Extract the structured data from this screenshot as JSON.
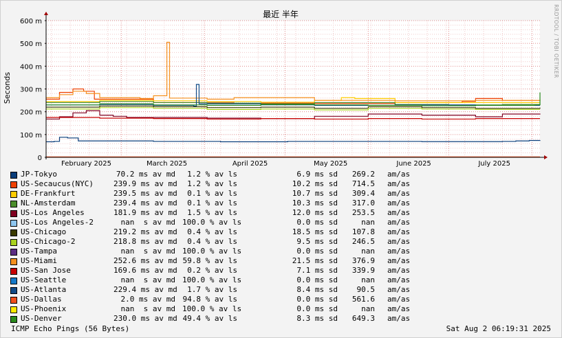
{
  "chart_data": {
    "type": "line",
    "title": "最近 半年",
    "ylabel": "Seconds",
    "vertical_label": "RRDTOOL / TOBI OETIKER",
    "y_ticks": [
      "0",
      "100 m",
      "200 m",
      "300 m",
      "400 m",
      "500 m",
      "600 m"
    ],
    "y_tick_values": [
      0,
      100,
      200,
      300,
      400,
      500,
      600
    ],
    "ylim": [
      0,
      600
    ],
    "x_ticks": [
      "February 2025",
      "March 2025",
      "April 2025",
      "May 2025",
      "June 2025",
      "July 2025"
    ],
    "x_tick_days": [
      15,
      45,
      76,
      106,
      137,
      167
    ],
    "xlim": [
      0,
      184
    ],
    "grid": true,
    "series": [
      {
        "name": "JP-Tokyo",
        "color": "#0a3d7a",
        "values": [
          [
            0,
            68
          ],
          [
            3,
            70
          ],
          [
            5,
            88
          ],
          [
            8,
            85
          ],
          [
            12,
            72
          ],
          [
            20,
            72
          ],
          [
            40,
            70
          ],
          [
            65,
            68
          ],
          [
            90,
            70
          ],
          [
            115,
            70
          ],
          [
            140,
            69
          ],
          [
            165,
            69
          ],
          [
            170,
            70
          ],
          [
            175,
            72
          ],
          [
            180,
            74
          ],
          [
            184,
            75
          ]
        ]
      },
      {
        "name": "US-Secaucus(NYC)",
        "color": "#ee4000",
        "values": [
          [
            0,
            255
          ],
          [
            5,
            285
          ],
          [
            10,
            300
          ],
          [
            14,
            290
          ],
          [
            18,
            255
          ],
          [
            40,
            240
          ],
          [
            70,
            238
          ],
          [
            100,
            236
          ],
          [
            130,
            240
          ],
          [
            155,
            245
          ],
          [
            160,
            258
          ],
          [
            170,
            250
          ],
          [
            184,
            252
          ]
        ]
      },
      {
        "name": "DE-Frankfurt",
        "color": "#ffcc00",
        "values": [
          [
            0,
            245
          ],
          [
            20,
            250
          ],
          [
            40,
            248
          ],
          [
            60,
            245
          ],
          [
            80,
            242
          ],
          [
            100,
            250
          ],
          [
            110,
            262
          ],
          [
            115,
            258
          ],
          [
            130,
            240
          ],
          [
            160,
            240
          ],
          [
            184,
            240
          ]
        ]
      },
      {
        "name": "NL-Amsterdam",
        "color": "#4b8e2b",
        "values": [
          [
            0,
            240
          ],
          [
            20,
            245
          ],
          [
            40,
            240
          ],
          [
            60,
            238
          ],
          [
            80,
            235
          ],
          [
            100,
            240
          ],
          [
            130,
            232
          ],
          [
            150,
            230
          ],
          [
            170,
            232
          ],
          [
            184,
            230
          ]
        ]
      },
      {
        "name": "US-Los Angeles",
        "color": "#800020",
        "values": [
          [
            0,
            168
          ],
          [
            5,
            178
          ],
          [
            10,
            195
          ],
          [
            15,
            205
          ],
          [
            20,
            185
          ],
          [
            25,
            180
          ],
          [
            30,
            175
          ],
          [
            60,
            172
          ],
          [
            80,
            170
          ],
          [
            100,
            180
          ],
          [
            120,
            190
          ],
          [
            140,
            185
          ],
          [
            160,
            178
          ],
          [
            170,
            190
          ],
          [
            184,
            188
          ]
        ]
      },
      {
        "name": "US-Los Angeles-2",
        "color": "#8ec6f0",
        "values": []
      },
      {
        "name": "US-Chicago",
        "color": "#3a3a00",
        "values": [
          [
            0,
            220
          ],
          [
            20,
            225
          ],
          [
            40,
            222
          ],
          [
            60,
            218
          ],
          [
            80,
            220
          ],
          [
            100,
            215
          ],
          [
            120,
            222
          ],
          [
            140,
            218
          ],
          [
            160,
            215
          ],
          [
            184,
            218
          ]
        ]
      },
      {
        "name": "US-Chicago-2",
        "color": "#a9d31f",
        "values": [
          [
            0,
            212
          ],
          [
            20,
            218
          ],
          [
            40,
            215
          ],
          [
            60,
            210
          ],
          [
            80,
            212
          ],
          [
            100,
            208
          ],
          [
            120,
            215
          ],
          [
            140,
            212
          ],
          [
            160,
            210
          ],
          [
            184,
            210
          ]
        ]
      },
      {
        "name": "US-Tampa",
        "color": "#5a2d82",
        "values": []
      },
      {
        "name": "US-Miami",
        "color": "#f5901e",
        "values": [
          [
            0,
            262
          ],
          [
            5,
            275
          ],
          [
            10,
            290
          ],
          [
            15,
            280
          ],
          [
            20,
            262
          ],
          [
            35,
            258
          ],
          [
            40,
            270
          ],
          [
            45,
            505
          ],
          [
            46,
            260
          ],
          [
            60,
            255
          ],
          [
            70,
            262
          ],
          [
            100,
            250
          ],
          [
            130,
            248
          ],
          [
            160,
            250
          ],
          [
            184,
            252
          ]
        ]
      },
      {
        "name": "US-San Jose",
        "color": "#c80000",
        "values": [
          [
            0,
            175
          ],
          [
            20,
            172
          ],
          [
            40,
            170
          ],
          [
            60,
            168
          ],
          [
            80,
            170
          ],
          [
            100,
            168
          ],
          [
            120,
            170
          ],
          [
            140,
            168
          ],
          [
            160,
            170
          ],
          [
            184,
            170
          ]
        ]
      },
      {
        "name": "US-Seattle",
        "color": "#1479c8",
        "values": []
      },
      {
        "name": "US-Atlanta",
        "color": "#114a86",
        "values": [
          [
            0,
            230
          ],
          [
            20,
            232
          ],
          [
            40,
            228
          ],
          [
            55,
            225
          ],
          [
            56,
            320
          ],
          [
            57,
            235
          ],
          [
            80,
            230
          ],
          [
            100,
            228
          ],
          [
            130,
            230
          ],
          [
            160,
            228
          ],
          [
            184,
            228
          ]
        ]
      },
      {
        "name": "US-Dallas",
        "color": "#f04e1c",
        "values": [
          [
            0,
            2
          ],
          [
            90,
            2
          ],
          [
            184,
            2
          ]
        ]
      },
      {
        "name": "US-Phoenix",
        "color": "#ffea00",
        "values": []
      },
      {
        "name": "US-Denver",
        "color": "#2b8a1e",
        "values": [
          [
            0,
            230
          ],
          [
            20,
            235
          ],
          [
            40,
            230
          ],
          [
            60,
            228
          ],
          [
            80,
            232
          ],
          [
            100,
            230
          ],
          [
            120,
            228
          ],
          [
            140,
            226
          ],
          [
            160,
            228
          ],
          [
            182,
            230
          ],
          [
            184,
            285
          ]
        ]
      }
    ]
  },
  "legend": [
    {
      "swatch": "#0a3d7a",
      "name": "JP-Tokyo",
      "avg": "70.2 ms av md",
      "loss": "1.2 % av ls",
      "sd": "6.9 ms sd",
      "max": "269.2",
      "unit": "am/as"
    },
    {
      "swatch": "#ee4000",
      "name": "US-Secaucus(NYC)",
      "avg": "239.9 ms av md",
      "loss": "1.2 % av ls",
      "sd": "10.2 ms sd",
      "max": "714.5",
      "unit": "am/as"
    },
    {
      "swatch": "#ffcc00",
      "name": "DE-Frankfurt",
      "avg": "239.5 ms av md",
      "loss": "0.1 % av ls",
      "sd": "10.7 ms sd",
      "max": "309.4",
      "unit": "am/as"
    },
    {
      "swatch": "#4b8e2b",
      "name": "NL-Amsterdam",
      "avg": "239.4 ms av md",
      "loss": "0.1 % av ls",
      "sd": "10.3 ms sd",
      "max": "317.0",
      "unit": "am/as"
    },
    {
      "swatch": "#800020",
      "name": "US-Los Angeles",
      "avg": "181.9 ms av md",
      "loss": "1.5 % av ls",
      "sd": "12.0 ms sd",
      "max": "253.5",
      "unit": "am/as"
    },
    {
      "swatch": "#8ec6f0",
      "name": "US-Los Angeles-2",
      "avg": "nan  s av md",
      "loss": "100.0 % av ls",
      "sd": "0.0 ms sd",
      "max": "nan",
      "unit": "am/as"
    },
    {
      "swatch": "#3a3a00",
      "name": "US-Chicago",
      "avg": "219.2 ms av md",
      "loss": "0.4 % av ls",
      "sd": "18.5 ms sd",
      "max": "107.8",
      "unit": "am/as"
    },
    {
      "swatch": "#a9d31f",
      "name": "US-Chicago-2",
      "avg": "218.8 ms av md",
      "loss": "0.4 % av ls",
      "sd": "9.5 ms sd",
      "max": "246.5",
      "unit": "am/as"
    },
    {
      "swatch": "#5a2d82",
      "name": "US-Tampa",
      "avg": "nan  s av md",
      "loss": "100.0 % av ls",
      "sd": "0.0 ms sd",
      "max": "nan",
      "unit": "am/as"
    },
    {
      "swatch": "#f5901e",
      "name": "US-Miami",
      "avg": "252.6 ms av md",
      "loss": "59.8 % av ls",
      "sd": "21.5 ms sd",
      "max": "376.9",
      "unit": "am/as"
    },
    {
      "swatch": "#c80000",
      "name": "US-San Jose",
      "avg": "169.6 ms av md",
      "loss": "0.2 % av ls",
      "sd": "7.1 ms sd",
      "max": "339.9",
      "unit": "am/as"
    },
    {
      "swatch": "#1479c8",
      "name": "US-Seattle",
      "avg": "nan  s av md",
      "loss": "100.0 % av ls",
      "sd": "0.0 ms sd",
      "max": "nan",
      "unit": "am/as"
    },
    {
      "swatch": "#114a86",
      "name": "US-Atlanta",
      "avg": "229.4 ms av md",
      "loss": "1.7 % av ls",
      "sd": "8.4 ms sd",
      "max": "90.5",
      "unit": "am/as"
    },
    {
      "swatch": "#f04e1c",
      "name": "US-Dallas",
      "avg": "2.0 ms av md",
      "loss": "94.8 % av ls",
      "sd": "0.0 ms sd",
      "max": "561.6",
      "unit": "am/as"
    },
    {
      "swatch": "#ffea00",
      "name": "US-Phoenix",
      "avg": "nan  s av md",
      "loss": "100.0 % av ls",
      "sd": "0.0 ms sd",
      "max": "nan",
      "unit": "am/as"
    },
    {
      "swatch": "#2b8a1e",
      "name": "US-Denver",
      "avg": "230.0 ms av md",
      "loss": "49.4 % av ls",
      "sd": "8.3 ms sd",
      "max": "649.3",
      "unit": "am/as"
    }
  ],
  "footer": {
    "left": "ICMP Echo Pings (56 Bytes)",
    "right": "Sat Aug  2 06:19:31 2025"
  }
}
